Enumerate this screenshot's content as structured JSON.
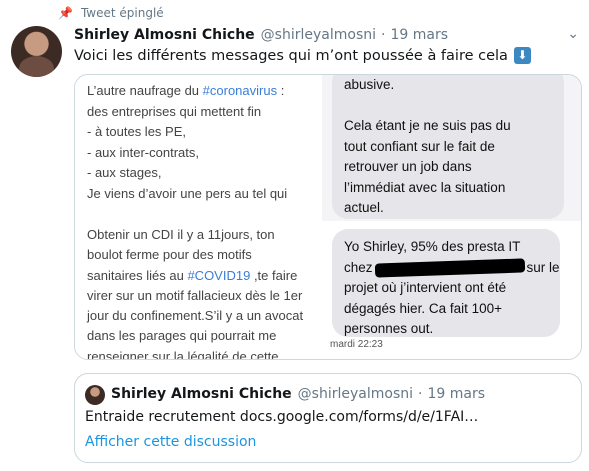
{
  "pinned_label": "Tweet épinglé",
  "tweet": {
    "author_name": "Shirley Almosni Chiche",
    "author_handle": "@shirleyalmosni",
    "separator": "·",
    "time": "19 mars",
    "text": "Voici les différents messages qui m’ont poussée à faire cela",
    "emoji_icon": "down-arrow-emoji",
    "menu_icon": "chevron-down-icon"
  },
  "media": {
    "pane1_lines": [
      {
        "pre": "L’autre naufrage du ",
        "tag": "#coronavirus",
        "post": " :"
      },
      {
        "pre": "des entreprises qui mettent fin",
        "tag": "",
        "post": ""
      },
      {
        "pre": "- à toutes les PE,",
        "tag": "",
        "post": ""
      },
      {
        "pre": "- aux inter-contrats,",
        "tag": "",
        "post": ""
      },
      {
        "pre": "- aux stages,",
        "tag": "",
        "post": ""
      },
      {
        "pre": "Je viens d’avoir une pers au tel qui",
        "tag": "",
        "post": ""
      }
    ],
    "pane2_lines": [
      {
        "pre": "Obtenir un CDI il y a 11jours, ton",
        "tag": "",
        "post": ""
      },
      {
        "pre": "boulot ferme pour des motifs",
        "tag": "",
        "post": ""
      },
      {
        "pre": "sanitaires liés au ",
        "tag": "#COVID19",
        "post": " ,te faire"
      },
      {
        "pre": "virer sur un motif fallacieux dès le 1er",
        "tag": "",
        "post": ""
      },
      {
        "pre": "jour du confinement.S’il y a un avocat",
        "tag": "",
        "post": ""
      },
      {
        "pre": "dans les parages qui pourrait me",
        "tag": "",
        "post": ""
      },
      {
        "pre": "renseigner sur la légalité de cette",
        "tag": "",
        "post": ""
      }
    ],
    "pane3_lines": [
      "abusive.",
      "",
      "Cela étant je ne suis pas du",
      "tout confiant sur le fait de",
      "retrouver un job dans",
      "l’immédiat avec la situation",
      "actuel."
    ],
    "pane4": {
      "line1": "Yo Shirley, 95% des presta IT",
      "line2_pre": "chez",
      "line2_post": "sur le",
      "line3": "projet où j’intervient ont été",
      "line4": "dégagés hier. Ca fait 100+",
      "line5": "personnes out.",
      "timestamp": "mardi 22:23"
    }
  },
  "quote": {
    "author_name": "Shirley Almosni Chiche",
    "author_handle": "@shirleyalmosni",
    "separator": "·",
    "time": "19 mars",
    "text": "Entraide recrutement  docs.google.com/forms/d/e/1FAI…",
    "link_label": "Afficher cette discussion"
  }
}
